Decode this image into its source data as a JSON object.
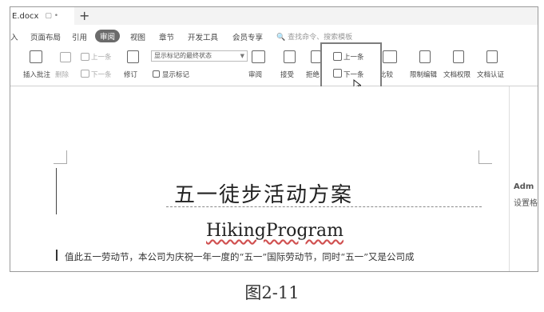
{
  "tab": {
    "file_name": "E.docx",
    "ctrl": "▢  •",
    "new_tab": "+"
  },
  "menu": {
    "items": [
      "入",
      "页面布局",
      "引用",
      "审阅",
      "视图",
      "章节",
      "开发工具",
      "会员专享"
    ],
    "active": "审阅",
    "search_placeholder": "查找命令、搜索模板"
  },
  "ribbon": {
    "insert_comment": "插入批注",
    "delete": "删除",
    "prev_comment": "上一条",
    "next_comment": "下一条",
    "revise": "修订",
    "display_select": "显示标记的最终状态",
    "show_marks": "显示标记",
    "review": "审阅",
    "accept": "接受",
    "reject": "拒绝",
    "prev_change": "上一条",
    "next_change": "下一条",
    "compare": "比较",
    "restrict_edit": "限制编辑",
    "doc_permission": "文档权限",
    "doc_verify": "文档认证"
  },
  "document": {
    "title_cn": "五一徒步活动方案",
    "title_en": "HikingProgram",
    "paragraph": "值此五一劳动节，本公司为庆祝一年一度的“五一”国际劳动节，同时“五一”又是公司成"
  },
  "side_panel": {
    "name": "Adm",
    "sub": "设置格"
  },
  "caption": "图2-11"
}
